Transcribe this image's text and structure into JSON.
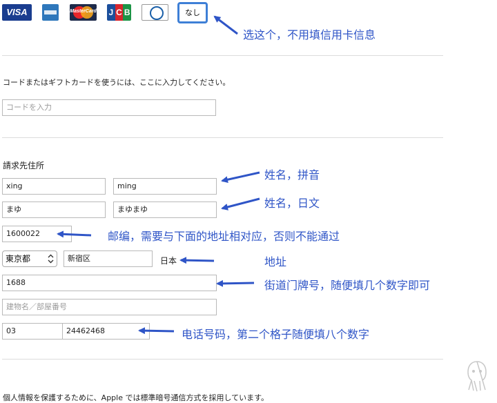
{
  "payment": {
    "cards": [
      {
        "name": "visa",
        "label": "VISA"
      },
      {
        "name": "amex",
        "label": ""
      },
      {
        "name": "mastercard",
        "label": "MasterCard"
      },
      {
        "name": "jcb",
        "label": "JCB"
      },
      {
        "name": "diners",
        "label": ""
      }
    ],
    "none_option": "なし"
  },
  "gift": {
    "prompt": "コードまたはギフトカードを使うには、ここに入力してください。",
    "placeholder": "コードを入力"
  },
  "billing": {
    "title": "請求先住所",
    "last_name_roman": "xing",
    "first_name_roman": "ming",
    "last_name_kana": "まゆ",
    "first_name_kana": "まゆまゆ",
    "postal_code": "1600022",
    "prefecture": "東京都",
    "city": "新宿区",
    "country": "日本",
    "street": "1688",
    "building_placeholder": "建物名／部屋番号",
    "phone_area": "03",
    "phone_number": "24462468"
  },
  "privacy_text": "個人情報を保護するために、Apple では標準暗号通信方式を採用しています。",
  "annotations": {
    "none_option": "选这个，不用填信用卡信息",
    "name_pinyin": "姓名，拼音",
    "name_japanese": "姓名，日文",
    "postal": "邮编，需要与下面的地址相对应，否则不能通过",
    "address": "地址",
    "street": "街道门牌号，随便填几个数字即可",
    "phone": "电话号码，第二个格子随便填八个数字"
  },
  "colors": {
    "annotation": "#2f55c7",
    "selected_border": "#3e7fd6"
  },
  "icons": [
    "card-visa-icon",
    "card-amex-icon",
    "card-mastercard-icon",
    "card-jcb-icon",
    "card-diners-icon",
    "chevron-updown-icon",
    "arrow-icon",
    "ghost-mascot-icon"
  ]
}
